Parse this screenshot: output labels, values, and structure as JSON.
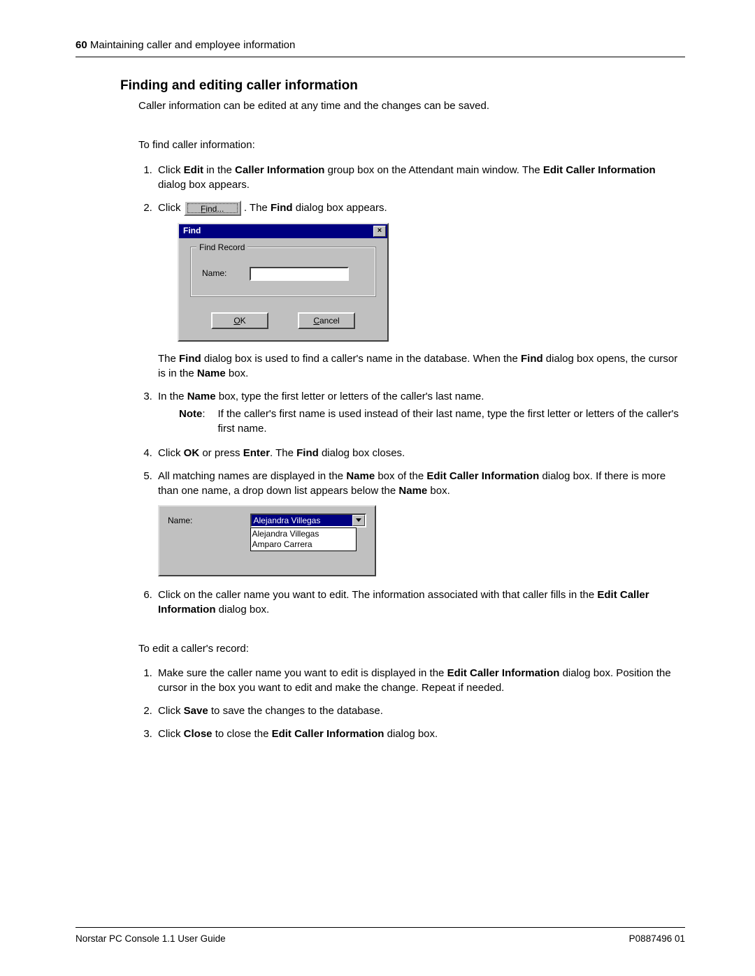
{
  "header": {
    "page_number": "60",
    "chapter_title": "Maintaining caller and employee information"
  },
  "section_title": "Finding and editing caller information",
  "intro": "Caller information can be edited at any time and the changes can be saved.",
  "to_find_lead": "To find caller information:",
  "find_button_label": "Find...",
  "steps_find": {
    "s1_pre": "Click ",
    "s1_b1": "Edit",
    "s1_mid1": " in the ",
    "s1_b2": "Caller Information",
    "s1_mid2": " group box on the Attendant main window. The ",
    "s1_b3": "Edit Caller Information",
    "s1_post": " dialog box appears.",
    "s2_pre": "Click ",
    "s2_mid": ". The ",
    "s2_b1": "Find",
    "s2_post": " dialog box appears.",
    "after2_a": "The ",
    "after2_b1": "Find",
    "after2_b": " dialog box is used to find a caller's name in the database. When the ",
    "after2_b2": "Find",
    "after2_c": " dialog box opens, the cursor is in the ",
    "after2_b3": "Name",
    "after2_d": " box.",
    "s3_pre": "In the ",
    "s3_b1": "Name",
    "s3_post": " box, type the first letter or letters of the caller's last name.",
    "note_label": "Note",
    "note_text": "If the caller's first name is used instead of their last name, type the first letter or letters of the caller's first name.",
    "s4_pre": "Click ",
    "s4_b1": "OK",
    "s4_mid": " or press ",
    "s4_b2": "Enter",
    "s4_mid2": ". The ",
    "s4_b3": "Find",
    "s4_post": " dialog box closes.",
    "s5_pre": "All matching names are displayed in the ",
    "s5_b1": "Name",
    "s5_mid": " box of the ",
    "s5_b2": "Edit Caller Information",
    "s5_mid2": " dialog box. If there is more than one name, a drop down list appears below the ",
    "s5_b3": "Name",
    "s5_post": " box.",
    "s6_pre": "Click on the caller name you want to edit. The information associated with that caller fills in the ",
    "s6_b1": "Edit Caller Information",
    "s6_post": " dialog box."
  },
  "find_dialog": {
    "title": "Find",
    "group_title": "Find Record",
    "name_label": "Name:",
    "ok_prefix": "O",
    "ok_rest": "K",
    "cancel_prefix": "C",
    "cancel_rest": "ancel"
  },
  "name_panel": {
    "label": "Name:",
    "selected": "Alejandra Villegas",
    "options": [
      "Alejandra Villegas",
      "Amparo Carrera"
    ]
  },
  "to_edit_lead": "To edit a caller's record:",
  "steps_edit": {
    "s1_pre": "Make sure the caller name you want to edit is displayed in the ",
    "s1_b1": "Edit Caller Information",
    "s1_post": " dialog box. Position the cursor in the box you want to edit and make the change. Repeat if needed.",
    "s2_pre": "Click ",
    "s2_b1": "Save",
    "s2_post": " to save the changes to the database.",
    "s3_pre": "Click ",
    "s3_b1": "Close",
    "s3_mid": " to close the ",
    "s3_b2": "Edit Caller Information",
    "s3_post": " dialog box."
  },
  "footer": {
    "left": "Norstar PC Console 1.1 User Guide",
    "right": "P0887496 01"
  }
}
